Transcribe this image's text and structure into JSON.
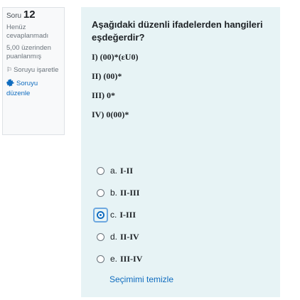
{
  "info": {
    "question_word": "Soru",
    "question_number": "12",
    "state": "Henüz cevaplanmadı",
    "grade": "5,00 üzerinden puanlanmış",
    "flag_label": "Soruyu işaretle",
    "edit_label": "Soruyu düzenle"
  },
  "question": {
    "text": "Aşağıdaki düzenli ifadelerden hangileri eşdeğerdir?",
    "statements": [
      "I) (00)*(εU0)",
      "II) (00)*",
      "III) 0*",
      "IV) 0(00)*"
    ]
  },
  "answers": [
    {
      "letter": "a.",
      "value": "I-II",
      "checked": false
    },
    {
      "letter": "b.",
      "value": "II-III",
      "checked": false
    },
    {
      "letter": "c.",
      "value": "I-III",
      "checked": true
    },
    {
      "letter": "d.",
      "value": "II-IV",
      "checked": false
    },
    {
      "letter": "e.",
      "value": "III-IV",
      "checked": false
    }
  ],
  "clear_choice_label": "Seçimimi temizle",
  "colors": {
    "content_bg": "#e7f3f5",
    "link": "#0f6cbf",
    "info_bg": "#f8f9fa"
  }
}
